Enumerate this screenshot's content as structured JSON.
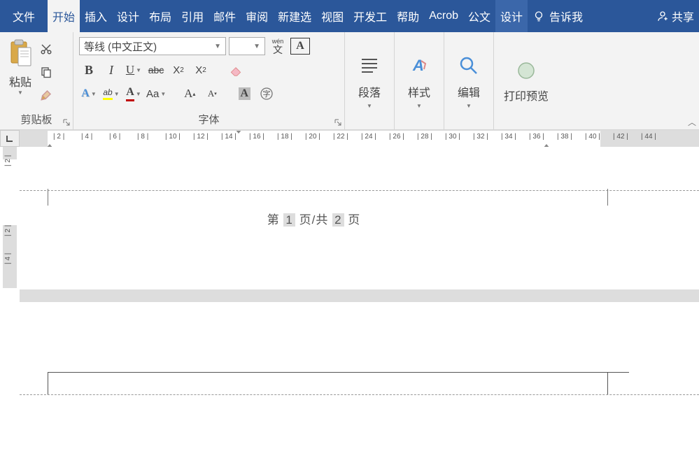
{
  "tabs": {
    "file": "文件",
    "home": "开始",
    "insert": "插入",
    "design1": "设计",
    "layout": "布局",
    "references": "引用",
    "mail": "邮件",
    "review": "审阅",
    "newtab": "新建选",
    "view": "视图",
    "developer": "开发工",
    "help": "帮助",
    "acrobat": "Acrob",
    "gongwen": "公文",
    "design2": "设计",
    "tellme": "告诉我",
    "share": "共享"
  },
  "clipboard": {
    "paste": "粘贴",
    "label": "剪贴板"
  },
  "font": {
    "name": "等线 (中文正文)",
    "size": "",
    "phonetic": "wén",
    "label": "字体"
  },
  "paragraph": {
    "label": "段落"
  },
  "styles": {
    "label": "样式"
  },
  "editing": {
    "label": "编辑"
  },
  "preview": {
    "label": "打印预览"
  },
  "hruler": [
    "2",
    "4",
    "6",
    "8",
    "10",
    "12",
    "14",
    "16",
    "18",
    "20",
    "22",
    "24",
    "26",
    "28",
    "30",
    "32",
    "34",
    "36",
    "38",
    "40",
    "42",
    "44"
  ],
  "vruler1": [
    "2"
  ],
  "vruler2": [
    "2",
    "4"
  ],
  "page": {
    "prefix": "第",
    "cur": "1",
    "mid": "页/共",
    "total": "2",
    "suffix": "页"
  }
}
